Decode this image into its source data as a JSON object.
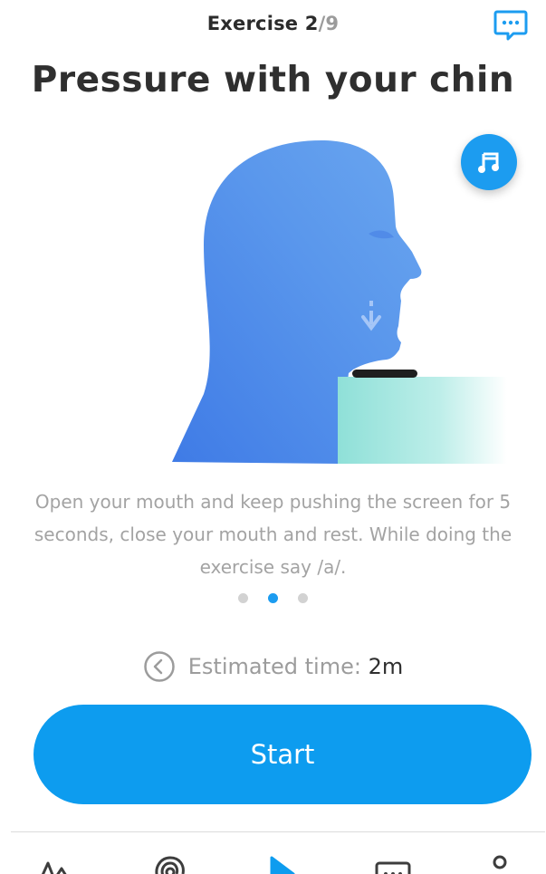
{
  "header": {
    "counter_label": "Exercise",
    "counter_current": "2",
    "counter_total": "/9",
    "feedback_icon": "chat-icon"
  },
  "exercise": {
    "title": "Pressure with your chin",
    "description": "Open your mouth and keep pushing the screen for 5 seconds, close your mouth and rest. While doing the exercise say /a/.",
    "music_icon": "music-note-icon",
    "pagination": {
      "count": 3,
      "active_index": 1
    }
  },
  "estimate": {
    "label": "Estimated time:",
    "value": "2m",
    "icon": "clock-back-icon"
  },
  "actions": {
    "start_label": "Start"
  },
  "bottom_nav": {
    "items": [
      {
        "icon": "activity-icon"
      },
      {
        "icon": "hearing-icon"
      },
      {
        "icon": "play-icon",
        "active": true
      },
      {
        "icon": "chat-icon"
      },
      {
        "icon": "profile-icon"
      }
    ]
  },
  "colors": {
    "accent": "#0d9cef",
    "head_gradient_start": "#6f9bf0",
    "head_gradient_end": "#3f7be6",
    "surface_gradient": "#8fe0d8",
    "text_primary": "#2f2f2f",
    "text_secondary": "#a3a3a3"
  }
}
